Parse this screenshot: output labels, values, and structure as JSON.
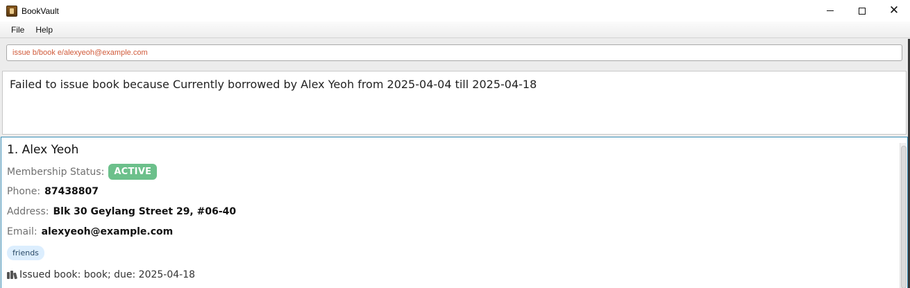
{
  "window": {
    "title": "BookVault",
    "icon": "bookvault-app-icon"
  },
  "menu": {
    "items": [
      {
        "label": "File"
      },
      {
        "label": "Help"
      }
    ]
  },
  "command": {
    "value": "issue b/book e/alexyeoh@example.com"
  },
  "result": {
    "text": "Failed to issue book because Currently borrowed by Alex Yeoh from 2025-04-04 till 2025-04-18"
  },
  "persons": [
    {
      "index_name": "1.  Alex Yeoh",
      "membership_label": "Membership Status:",
      "membership_status": "ACTIVE",
      "phone_label": "Phone:",
      "phone": "87438807",
      "address_label": "Address:",
      "address": "Blk 30 Geylang Street 29, #06-40",
      "email_label": "Email:",
      "email": "alexyeoh@example.com",
      "tags": [
        "friends"
      ],
      "issued_book": "Issued book: book; due: 2025-04-18"
    }
  ],
  "colors": {
    "active_badge": "#6cc08b",
    "tag_bg": "#dceefe",
    "command_text": "#d05a3a",
    "list_border": "#3a8fb7"
  }
}
